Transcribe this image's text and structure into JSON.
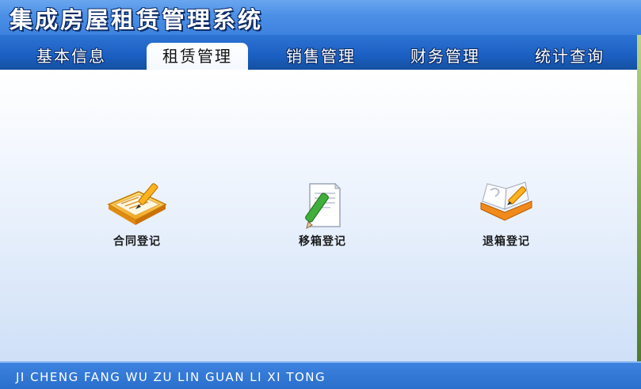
{
  "app": {
    "title": "集成房屋租赁管理系统",
    "footer": "JI CHENG FANG WU ZU LIN GUAN LI XI TONG"
  },
  "tabs": [
    {
      "label": "基本信息",
      "active": false
    },
    {
      "label": "租赁管理",
      "active": true
    },
    {
      "label": "销售管理",
      "active": false
    },
    {
      "label": "财务管理",
      "active": false
    },
    {
      "label": "统计查询",
      "active": false
    }
  ],
  "functions": [
    {
      "label": "合同登记",
      "icon": "contract-notebook-icon"
    },
    {
      "label": "移箱登记",
      "icon": "document-pencil-icon"
    },
    {
      "label": "退箱登记",
      "icon": "open-book-pencil-icon"
    }
  ],
  "colors": {
    "title_bar": "#4b8fe6",
    "tab_bar": "#1b5fc2",
    "footer": "#2b6fcd"
  }
}
